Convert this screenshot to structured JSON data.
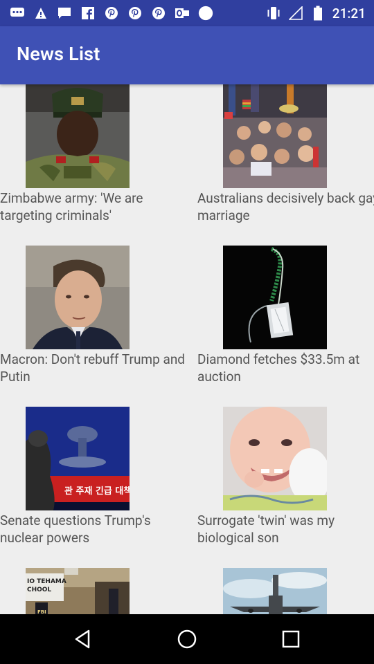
{
  "status_bar": {
    "time": "21:21",
    "left_icons": [
      "chat-icon",
      "alert-icon",
      "messages-icon",
      "facebook-icon",
      "pinterest-icon",
      "pinterest-icon",
      "pinterest-icon",
      "outlook-icon",
      "circle-icon"
    ],
    "right_icons": [
      "vibrate-icon",
      "signal-icon",
      "battery-icon"
    ]
  },
  "appbar": {
    "title": "News List"
  },
  "news": [
    {
      "headline": "Zimbabwe army: 'We are targeting criminals'",
      "image": "soldier-photo"
    },
    {
      "headline": "Australians decisively back gay marriage",
      "image": "crowd-photo"
    },
    {
      "headline": "Macron: Don't rebuff Trump and Putin",
      "image": "macron-photo"
    },
    {
      "headline": "Diamond fetches $33.5m at auction",
      "image": "diamond-photo"
    },
    {
      "headline": "Senate questions Trump's nuclear powers",
      "image": "tv-broadcast-photo"
    },
    {
      "headline": "Surrogate 'twin' was my biological son",
      "image": "baby-photo"
    },
    {
      "headline": "",
      "image": "school-photo"
    },
    {
      "headline": "",
      "image": "aircraft-photo"
    }
  ],
  "colors": {
    "status_bar": "#303f9f",
    "app_bar": "#3f51b5",
    "background": "#eeeeee",
    "headline_text": "#555555"
  }
}
